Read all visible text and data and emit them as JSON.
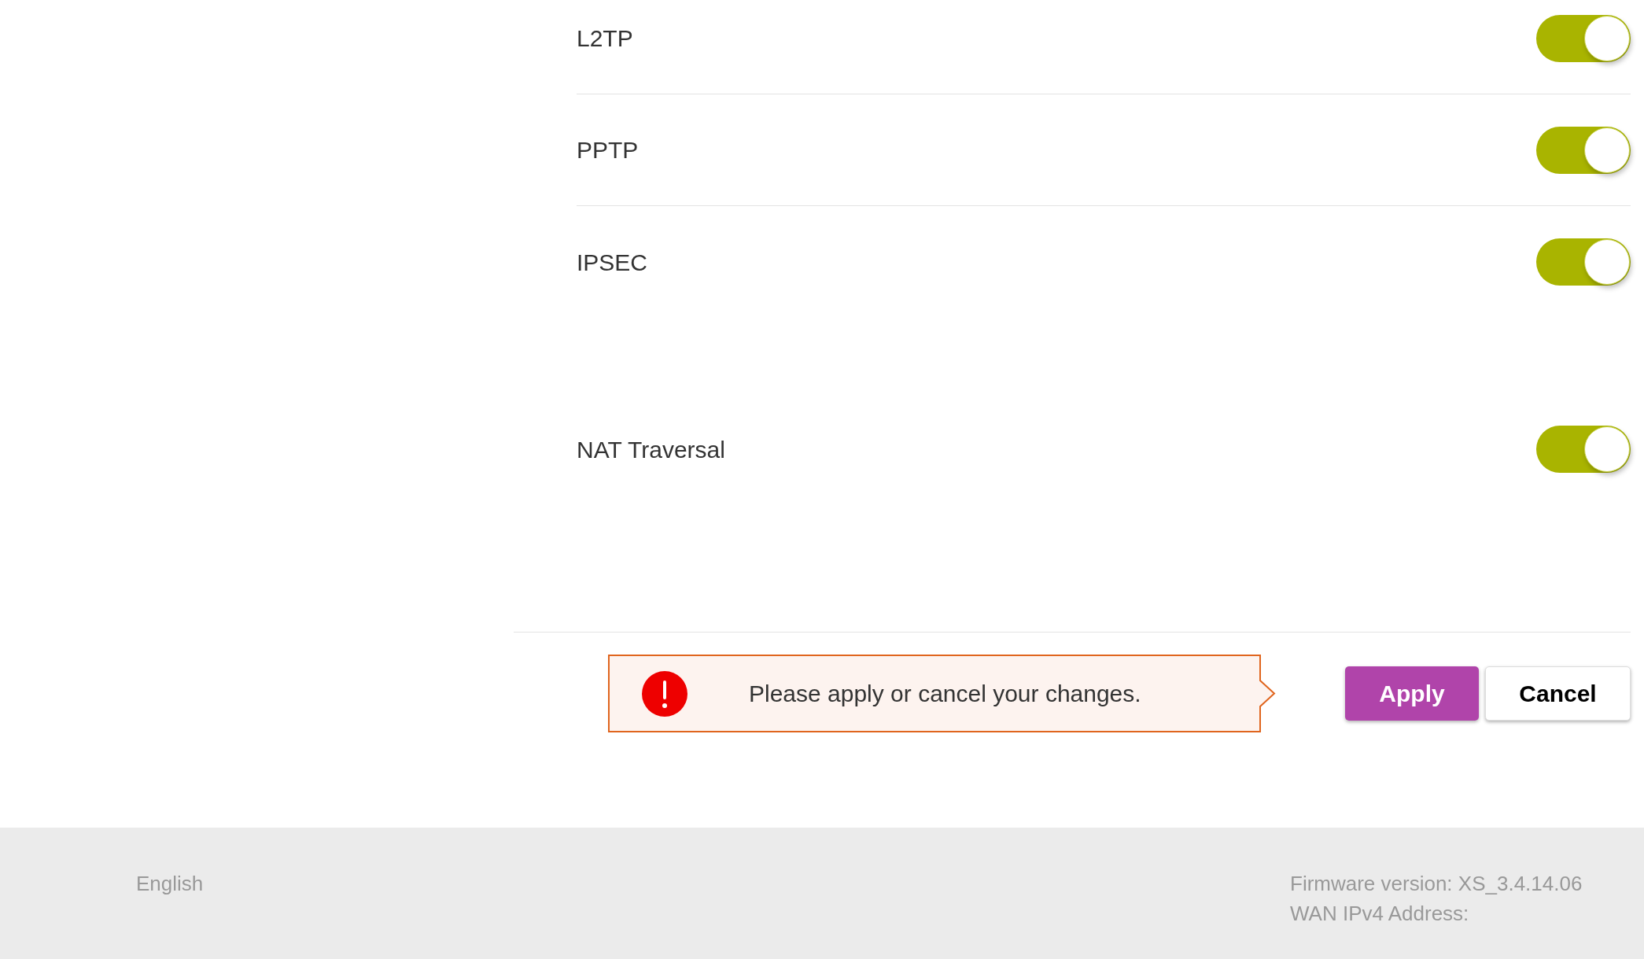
{
  "settings_groups": [
    {
      "items": [
        {
          "label": "L2TP",
          "on": true
        },
        {
          "label": "PPTP",
          "on": true
        },
        {
          "label": "IPSEC",
          "on": true
        }
      ]
    },
    {
      "items": [
        {
          "label": "NAT Traversal",
          "on": true
        }
      ]
    }
  ],
  "notice": {
    "message": "Please apply or cancel your changes."
  },
  "buttons": [
    {
      "label": "Apply",
      "kind": "primary"
    },
    {
      "label": "Cancel",
      "kind": "secondary"
    }
  ],
  "footer": {
    "language": "English",
    "firmware": "Firmware version: XS_3.4.14.06",
    "wan_address": "WAN IPv4 Address:"
  }
}
